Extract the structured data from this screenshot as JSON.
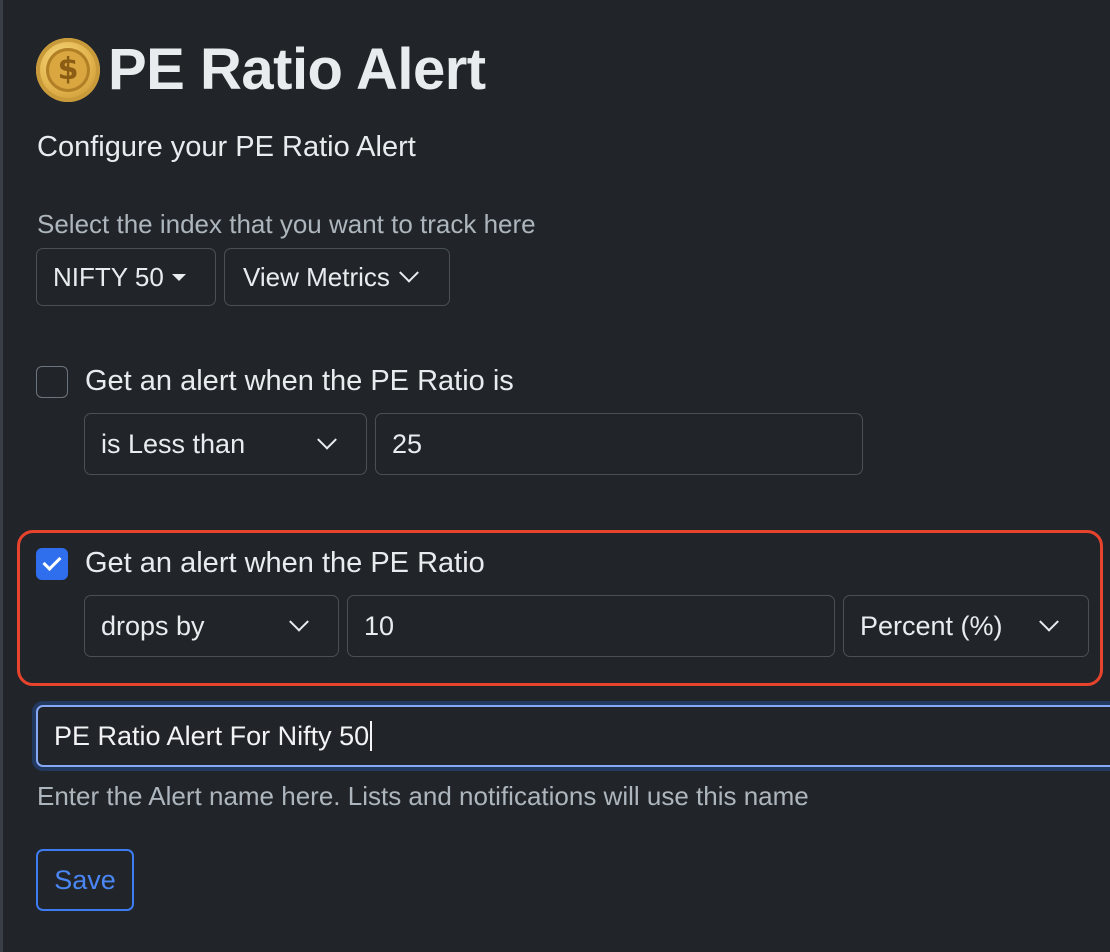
{
  "header": {
    "icon": "dollar-coin-icon",
    "title": "PE Ratio Alert",
    "subtitle": "Configure your PE Ratio Alert"
  },
  "index_section": {
    "hint": "Select the index that you want to track here",
    "index_dropdown": "NIFTY 50",
    "metrics_button": "View Metrics"
  },
  "alert_threshold": {
    "checked": false,
    "label": "Get an alert when the PE Ratio is",
    "condition": "is Less than",
    "value": "25"
  },
  "alert_change": {
    "checked": true,
    "label": "Get an alert when the PE Ratio",
    "direction": "drops by",
    "value": "10",
    "unit": "Percent (%)"
  },
  "alert_name": {
    "value": "PE Ratio Alert For Nifty 50",
    "helper": "Enter the Alert name here. Lists and notifications will use this name"
  },
  "actions": {
    "save_label": "Save"
  },
  "colors": {
    "background": "#212529",
    "accent": "#2f6fed",
    "highlight": "#e8432d"
  }
}
